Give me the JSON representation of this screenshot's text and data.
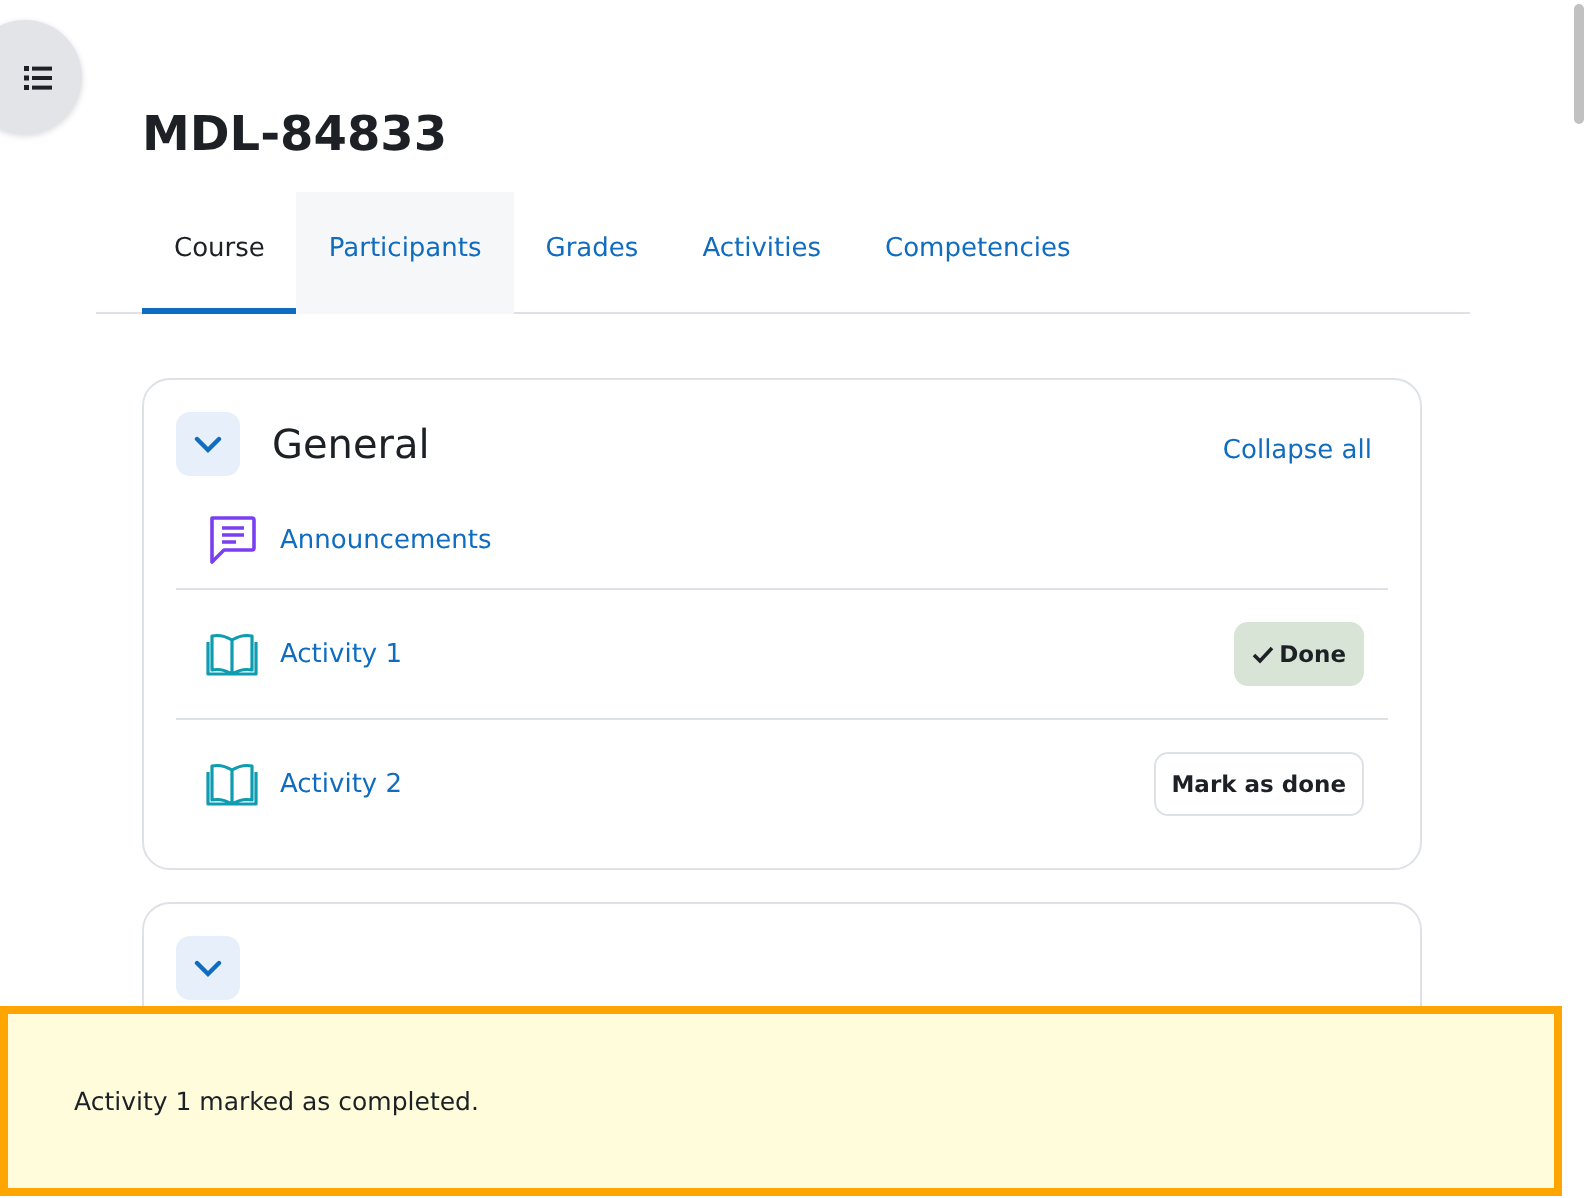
{
  "course": {
    "title": "MDL-84833"
  },
  "tabs": [
    {
      "label": "Course",
      "selected": true,
      "hovered": false
    },
    {
      "label": "Participants",
      "selected": false,
      "hovered": true
    },
    {
      "label": "Grades",
      "selected": false,
      "hovered": false
    },
    {
      "label": "Activities",
      "selected": false,
      "hovered": false
    },
    {
      "label": "Competencies",
      "selected": false,
      "hovered": false
    }
  ],
  "sections": [
    {
      "title": "General",
      "expanded": true,
      "action": "Collapse all",
      "activities": [
        {
          "name": "Announcements",
          "kind": "forum"
        },
        {
          "name": "Activity 1",
          "kind": "book",
          "completion": {
            "label": "Done",
            "done": true
          }
        },
        {
          "name": "Activity 2",
          "kind": "book",
          "completion": {
            "label": "Mark as done",
            "done": false
          }
        }
      ]
    },
    {
      "expanded": true
    }
  ],
  "toast": {
    "message": "Activity 1 marked as completed."
  }
}
